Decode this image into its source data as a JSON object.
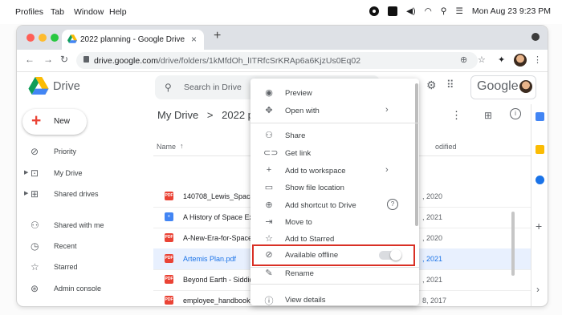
{
  "mac_menubar": {
    "items": [
      "Profiles",
      "Tab",
      "Window",
      "Help"
    ],
    "clock": "Mon Aug 23  9:23 PM"
  },
  "browser": {
    "tab_title": "2022 planning - Google Drive",
    "url_host": "drive.google.com",
    "url_path": "/drive/folders/1kMfdOh_lITRfcSrKRAp6a6KjzUs0Eq02"
  },
  "drive": {
    "app_name": "Drive",
    "search_placeholder": "Search in Drive",
    "google_label": "Google",
    "new_button": "New",
    "sidebar": [
      {
        "label": "Priority",
        "icon": "check-circle-icon",
        "expandable": false
      },
      {
        "label": "My Drive",
        "icon": "drive-icon",
        "expandable": true
      },
      {
        "label": "Shared drives",
        "icon": "shared-drives-icon",
        "expandable": true
      },
      {
        "label": "Shared with me",
        "icon": "people-icon",
        "expandable": false
      },
      {
        "label": "Recent",
        "icon": "clock-icon",
        "expandable": false
      },
      {
        "label": "Starred",
        "icon": "star-icon",
        "expandable": false
      },
      {
        "label": "Admin console",
        "icon": "admin-icon",
        "expandable": false
      }
    ],
    "breadcrumb": {
      "root": "My Drive",
      "separator": ">",
      "current": "2022 pla"
    },
    "columns": {
      "name": "Name",
      "modified": "odified"
    },
    "files": [
      {
        "name": "140708_Lewis_Spacet",
        "type": "pdf",
        "date": ", 2020",
        "selected": false
      },
      {
        "name": "A History of Space Ex",
        "type": "doc",
        "date": ", 2021",
        "selected": false
      },
      {
        "name": "A-New-Era-for-Space-",
        "type": "pdf",
        "date": ", 2020",
        "selected": false
      },
      {
        "name": "Artemis Plan.pdf",
        "type": "pdf",
        "date": ", 2021",
        "selected": true
      },
      {
        "name": "Beyond Earth - Siddiqu",
        "type": "pdf",
        "date": ", 2021",
        "selected": false
      },
      {
        "name": "employee_handbook.p",
        "type": "pdf",
        "date": "8, 2017",
        "selected": false
      }
    ],
    "context_menu": [
      {
        "label": "Preview",
        "icon": "eye-icon"
      },
      {
        "label": "Open with",
        "icon": "open-with-icon",
        "submenu": true
      },
      {
        "divider": true
      },
      {
        "label": "Share",
        "icon": "person-add-icon"
      },
      {
        "label": "Get link",
        "icon": "link-icon"
      },
      {
        "label": "Add to workspace",
        "icon": "plus-icon",
        "submenu": true
      },
      {
        "label": "Show file location",
        "icon": "folder-icon"
      },
      {
        "label": "Add shortcut to Drive",
        "icon": "add-shortcut-icon",
        "help": true
      },
      {
        "label": "Move to",
        "icon": "move-icon"
      },
      {
        "label": "Add to Starred",
        "icon": "star-icon"
      },
      {
        "label": "Available offline",
        "icon": "offline-check-icon",
        "toggle": true,
        "highlighted": true
      },
      {
        "divider": true
      },
      {
        "label": "Rename",
        "icon": "pencil-icon"
      },
      {
        "divider": true
      },
      {
        "label": "View details",
        "icon": "info-icon"
      }
    ]
  },
  "colors": {
    "highlight_border": "#d93025",
    "selected_row": "#e8f0fe",
    "selected_text": "#1a73e8",
    "pdf_red": "#ea4335",
    "doc_blue": "#4285f4"
  }
}
